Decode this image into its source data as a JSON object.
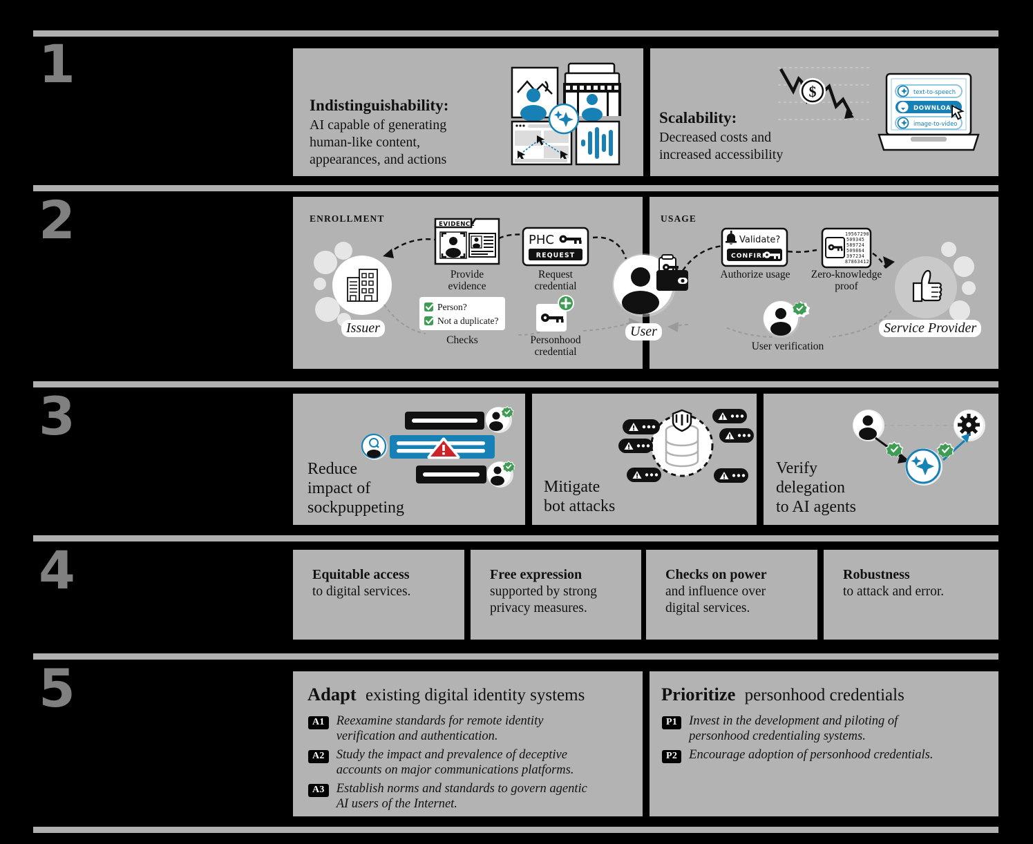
{
  "sections": [
    {
      "number": "1"
    },
    {
      "number": "2"
    },
    {
      "number": "3"
    },
    {
      "number": "4"
    },
    {
      "number": "5"
    }
  ],
  "section1": {
    "panels": [
      {
        "heading": "Indistinguishability:",
        "body_line1": "AI capable of generating",
        "body_line2": "human-like content,",
        "body_line3": "appearances, and actions"
      },
      {
        "heading": "Scalability:",
        "body_line1": "Decreased costs and",
        "body_line2": "increased accessibility"
      }
    ],
    "laptop_buttons": [
      "text-to-speech",
      "DOWNLOAD",
      "image-to-video"
    ],
    "currency_symbol": "$"
  },
  "section2": {
    "enrollment_label": "ENROLLMENT",
    "usage_label": "USAGE",
    "actors": {
      "issuer": "Issuer",
      "user": "User",
      "service_provider": "Service Provider"
    },
    "enrollment_steps": [
      {
        "caption_line1": "Provide",
        "caption_line2": "evidence",
        "badge": "EVIDENCE"
      },
      {
        "caption_line1": "Request",
        "caption_line2": "credential",
        "card_title": "PHC",
        "card_button": "REQUEST"
      },
      {
        "caption_line1": "Checks",
        "caption_line2": "",
        "check1": "Person?",
        "check2": "Not a duplicate?"
      },
      {
        "caption_line1": "Personhood",
        "caption_line2": "credential"
      }
    ],
    "usage_steps": [
      {
        "caption_line1": "Authorize usage",
        "caption_line2": "",
        "card_title": "Validate?",
        "card_button": "CONFIRM"
      },
      {
        "caption_line1": "Zero-knowledge",
        "caption_line2": "proof",
        "digits": [
          "19567290",
          "509345",
          "589724",
          "509864",
          "397234",
          "87863412"
        ]
      },
      {
        "caption_line1": "User verification",
        "caption_line2": ""
      }
    ]
  },
  "section3": {
    "panels": [
      {
        "line1": "Reduce",
        "line2": "impact of",
        "line3": "sockpuppeting"
      },
      {
        "line1": "Mitigate",
        "line2": "bot attacks",
        "line3": ""
      },
      {
        "line1": "Verify",
        "line2": "delegation",
        "line3": "to AI agents"
      }
    ]
  },
  "section4": {
    "items": [
      {
        "bold": "Equitable access",
        "rest_line1": "to digital services.",
        "rest_line2": ""
      },
      {
        "bold": "Free expression",
        "rest_line1": "supported by strong",
        "rest_line2": "privacy measures."
      },
      {
        "bold": "Checks on power",
        "rest_line1": "and influence over",
        "rest_line2": "digital services."
      },
      {
        "bold": "Robustness",
        "rest_line1": "to attack and error.",
        "rest_line2": ""
      }
    ]
  },
  "section5": {
    "columns": [
      {
        "head_bold": "Adapt",
        "head_rest": "existing digital identity systems",
        "recommendations": [
          {
            "tag": "A1",
            "line1": "Reexamine standards for remote identity",
            "line2": "verification and authentication."
          },
          {
            "tag": "A2",
            "line1": "Study the impact and prevalence of deceptive",
            "line2": "accounts on major communications platforms."
          },
          {
            "tag": "A3",
            "line1": "Establish norms and standards to govern agentic",
            "line2": "AI users of the Internet."
          }
        ]
      },
      {
        "head_bold": "Prioritize",
        "head_rest": "personhood credentials",
        "recommendations": [
          {
            "tag": "P1",
            "line1": "Invest in the development and piloting of",
            "line2": "personhood credentialing systems."
          },
          {
            "tag": "P2",
            "line1": "Encourage adoption of personhood credentials.",
            "line2": ""
          }
        ]
      }
    ]
  },
  "colors": {
    "background": "#000000",
    "panel": "#b3b3b3",
    "rule": "#b0b0b0",
    "numeral": "#808080",
    "accent_blue": "#1781b5",
    "check_green": "#3f9c54",
    "alert_red": "#cc2229"
  }
}
